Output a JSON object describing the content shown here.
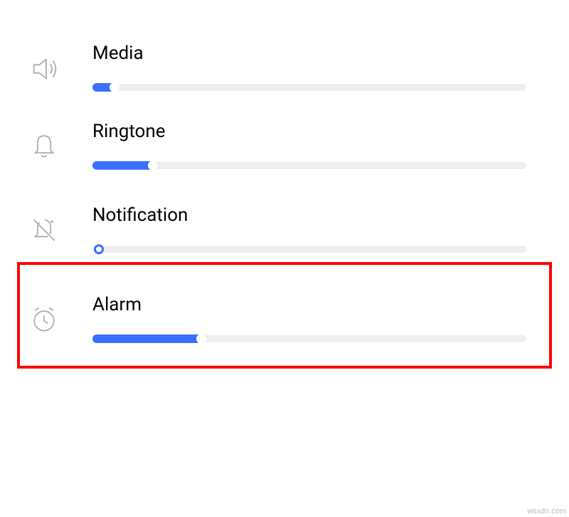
{
  "sliders": {
    "media": {
      "label": "Media",
      "value": 6,
      "icon": "speaker-icon"
    },
    "ringtone": {
      "label": "Ringtone",
      "value": 15,
      "icon": "bell-icon"
    },
    "notification": {
      "label": "Notification",
      "value": 0,
      "icon": "bell-muted-icon",
      "highlighted": true
    },
    "alarm": {
      "label": "Alarm",
      "value": 26,
      "icon": "clock-icon"
    }
  },
  "colors": {
    "accent": "#3a6fff",
    "track": "#eeeeee",
    "highlight": "#ff0000",
    "icon": "#b0b0b0"
  },
  "watermark": "wsxdn.com"
}
